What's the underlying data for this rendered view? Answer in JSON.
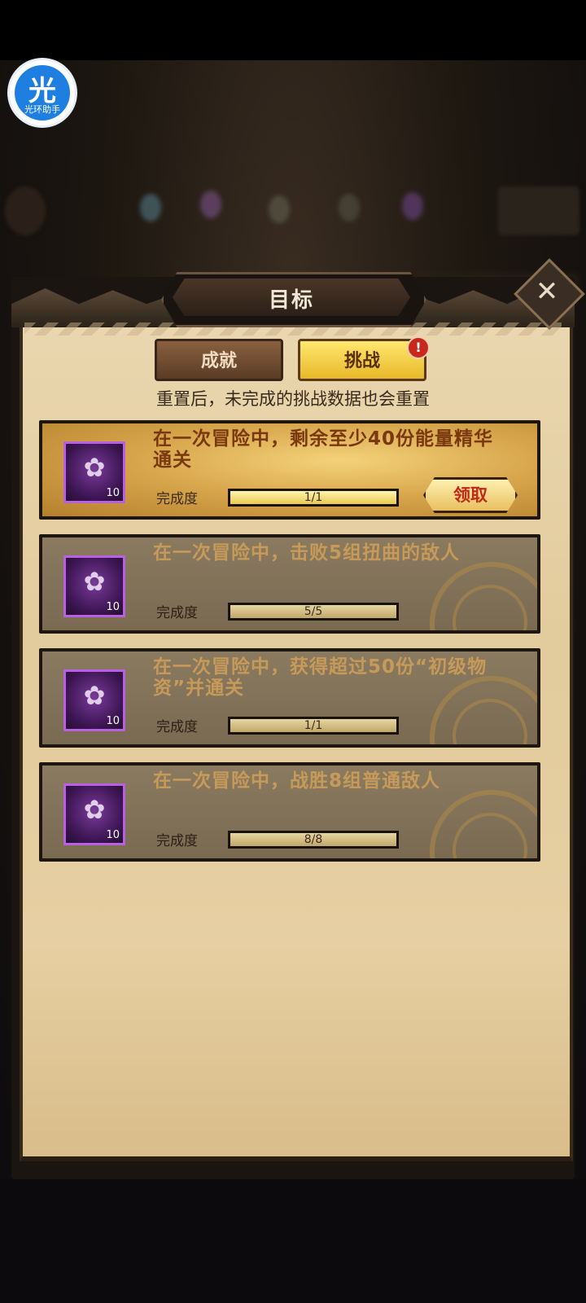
{
  "badge": {
    "glyph": "光",
    "text": "光环助手"
  },
  "dialog": {
    "title": "目标",
    "close_label": "✕"
  },
  "tabs": [
    {
      "label": "成就",
      "active": false
    },
    {
      "label": "挑战",
      "active": true,
      "alert": "!"
    }
  ],
  "notice": "重置后，未完成的挑战数据也会重置",
  "progress_label": "完成度",
  "challenges": [
    {
      "title": "在一次冒险中，剩余至少40份能量精华通关",
      "progress": "1/1",
      "fraction": 1.0,
      "reward_count": "10",
      "state": "claimable",
      "claim_label": "领取"
    },
    {
      "title": "在一次冒险中，击败5组扭曲的敌人",
      "progress": "5/5",
      "fraction": 1.0,
      "reward_count": "10",
      "state": "claimed"
    },
    {
      "title": "在一次冒险中，获得超过50份“初级物资”并通关",
      "progress": "1/1",
      "fraction": 1.0,
      "reward_count": "10",
      "state": "claimed"
    },
    {
      "title": "在一次冒险中，战胜8组普通敌人",
      "progress": "8/8",
      "fraction": 1.0,
      "reward_count": "10",
      "state": "claimed"
    }
  ],
  "icons": {
    "reward": "scroll-reward-icon",
    "close": "close-icon",
    "badge": "app-badge-icon"
  }
}
